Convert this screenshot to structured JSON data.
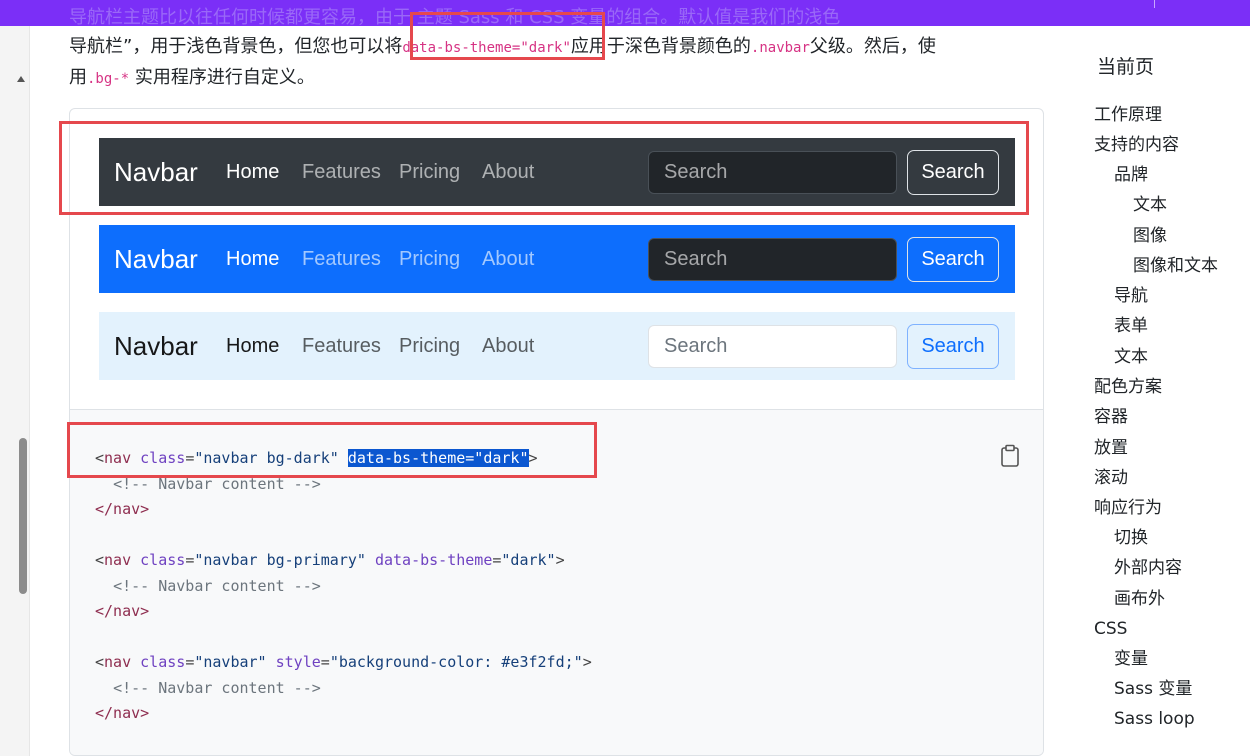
{
  "top": {
    "partial_text": "导航栏主题比以往任何时候都更容易，由于 主题 Sass 和 CSS 变量的组合。默认值是我们的浅色"
  },
  "intro": {
    "line1": "导航栏”，用于浅色背景色，但您也可以将",
    "code1": "data-bs-theme=\"dark\"",
    "line2": "应用于深色背景颜色的",
    "code2": ".navbar",
    "line3": "父级。然后，使",
    "line4": "用",
    "code3": ".bg-*",
    "line5": " 实用程序进行自定义。"
  },
  "navbars": [
    {
      "brand": "Navbar",
      "links": [
        "Home",
        "Features",
        "Pricing",
        "About"
      ],
      "search_placeholder": "Search",
      "search_button": "Search"
    },
    {
      "brand": "Navbar",
      "links": [
        "Home",
        "Features",
        "Pricing",
        "About"
      ],
      "search_placeholder": "Search",
      "search_button": "Search"
    },
    {
      "brand": "Navbar",
      "links": [
        "Home",
        "Features",
        "Pricing",
        "About"
      ],
      "search_placeholder": "Search",
      "search_button": "Search"
    }
  ],
  "code": {
    "tag_nav": "nav",
    "attr_class": "class",
    "attr_theme": "data-bs-theme",
    "attr_style": "style",
    "val_dark_cls": "\"navbar bg-dark\"",
    "val_primary_cls": "\"navbar bg-primary\"",
    "val_navbar": "\"navbar\"",
    "val_dark": "\"dark\"",
    "val_style": "\"background-color: #e3f2fd;\"",
    "selected": "data-bs-theme=\"dark\"",
    "comment": "<!-- Navbar content -->",
    "close": "</nav>"
  },
  "toc": {
    "title": "当前页",
    "items": [
      "工作原理",
      "支持的内容",
      "品牌",
      "文本",
      "图像",
      "图像和文本",
      "导航",
      "表单",
      "文本",
      "配色方案",
      "容器",
      "放置",
      "滚动",
      "响应行为",
      "切换",
      "外部内容",
      "画布外",
      "CSS",
      "变量",
      "Sass 变量",
      "Sass loop"
    ]
  },
  "colors": {
    "annotation": "#e5484d",
    "primary": "#0d6efd",
    "dark": "#343a40",
    "light_blue": "#e3f2fd",
    "top_bar": "#7b2ff7"
  }
}
